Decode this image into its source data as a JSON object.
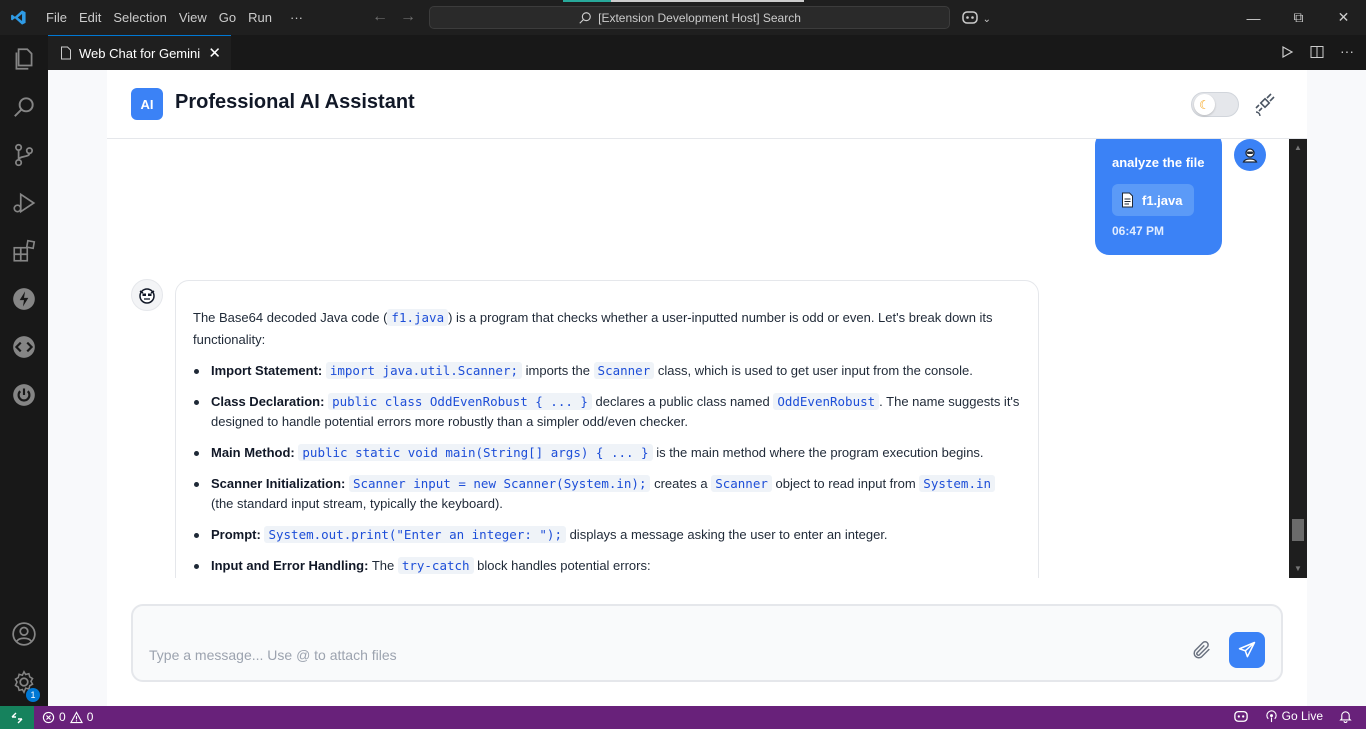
{
  "titlebar": {
    "menu": [
      "File",
      "Edit",
      "Selection",
      "View",
      "Go",
      "Run",
      "···"
    ],
    "search": "[Extension Development Host] Search"
  },
  "tab": {
    "label": "Web Chat for Gemini"
  },
  "app": {
    "badge": "AI",
    "title": "Professional AI Assistant"
  },
  "user_message": {
    "text": "analyze the file",
    "file": "f1.java",
    "time": "06:47 PM"
  },
  "bot_message": {
    "intro_a": "The Base64 decoded Java code (",
    "intro_code": "f1.java",
    "intro_b": ") is a program that checks whether a user-inputted number is odd or even. Let's break down its functionality:",
    "items": [
      {
        "label": "Import Statement:",
        "code1": "import java.util.Scanner;",
        "text1": " imports the ",
        "code2": "Scanner",
        "text2": " class, which is used to get user input from the console."
      },
      {
        "label": "Class Declaration:",
        "code1": "public class OddEvenRobust { ... }",
        "text1": " declares a public class named ",
        "code2": "OddEvenRobust",
        "text2": ". The name suggests it's designed to handle potential errors more robustly than a simpler odd/even checker."
      },
      {
        "label": "Main Method:",
        "code1": "public static void main(String[] args) { ... }",
        "text1": " is the main method where the program execution begins.",
        "code2": "",
        "text2": ""
      },
      {
        "label": "Scanner Initialization:",
        "code1": "Scanner input = new Scanner(System.in);",
        "text1": " creates a ",
        "code2": "Scanner",
        "text2": " object to read input from ",
        "code3": "System.in",
        "text3": " (the standard input stream, typically the keyboard)."
      },
      {
        "label": "Prompt:",
        "code1": "System.out.print(\"Enter an integer: \");",
        "text1": " displays a message asking the user to enter an integer.",
        "code2": "",
        "text2": ""
      },
      {
        "label": "Input and Error Handling:",
        "text0": " The ",
        "code1": "try-catch",
        "text1": " block handles potential errors:",
        "code2": "",
        "text2": ""
      }
    ]
  },
  "composer": {
    "placeholder": "Type a message... Use @ to attach files"
  },
  "statusbar": {
    "errors": "0",
    "warnings": "0",
    "golive": "Go Live"
  },
  "settings_badge": "1"
}
